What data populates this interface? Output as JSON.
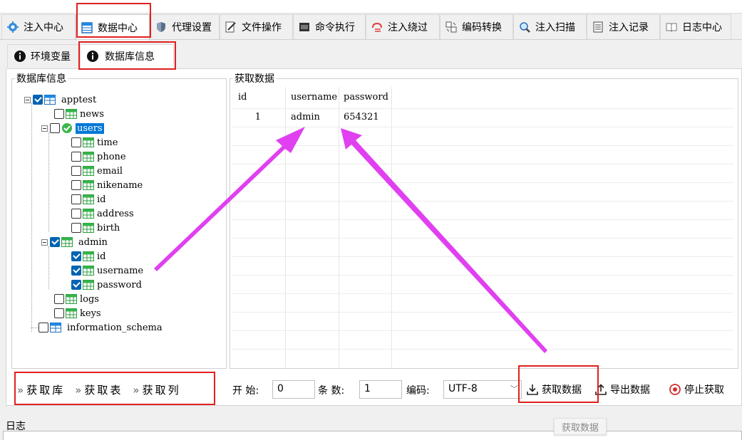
{
  "main_tabs": [
    {
      "label": "注入中心",
      "icon": "gear-icon"
    },
    {
      "label": "数据中心",
      "icon": "database-icon",
      "active": true
    },
    {
      "label": "代理设置",
      "icon": "shield-icon"
    },
    {
      "label": "文件操作",
      "icon": "edit-file-icon"
    },
    {
      "label": "命令执行",
      "icon": "terminal-icon"
    },
    {
      "label": "注入绕过",
      "icon": "bypass-icon"
    },
    {
      "label": "编码转换",
      "icon": "encode-icon"
    },
    {
      "label": "注入扫描",
      "icon": "scan-icon"
    },
    {
      "label": "注入记录",
      "icon": "record-icon"
    },
    {
      "label": "日志中心",
      "icon": "book-icon"
    }
  ],
  "sub_tabs": [
    {
      "label": "环境变量",
      "icon": "info-icon"
    },
    {
      "label": "数据库信息",
      "icon": "info-icon",
      "active": true
    }
  ],
  "db_panel": {
    "title": "数据库信息",
    "tree": [
      {
        "label": "apptest",
        "level": 0,
        "checked": true,
        "expanded": true,
        "kind": "database"
      },
      {
        "label": "news",
        "level": 1,
        "checked": false,
        "kind": "table"
      },
      {
        "label": "users",
        "level": 1,
        "checked": false,
        "expanded": true,
        "kind": "table-ok",
        "selected": true
      },
      {
        "label": "time",
        "level": 2,
        "checked": false,
        "kind": "column"
      },
      {
        "label": "phone",
        "level": 2,
        "checked": false,
        "kind": "column"
      },
      {
        "label": "email",
        "level": 2,
        "checked": false,
        "kind": "column"
      },
      {
        "label": "nikename",
        "level": 2,
        "checked": false,
        "kind": "column"
      },
      {
        "label": "id",
        "level": 2,
        "checked": false,
        "kind": "column"
      },
      {
        "label": "address",
        "level": 2,
        "checked": false,
        "kind": "column"
      },
      {
        "label": "birth",
        "level": 2,
        "checked": false,
        "kind": "column"
      },
      {
        "label": "admin",
        "level": 1,
        "checked": true,
        "expanded": true,
        "kind": "table"
      },
      {
        "label": "id",
        "level": 2,
        "checked": true,
        "kind": "column"
      },
      {
        "label": "username",
        "level": 2,
        "checked": true,
        "kind": "column"
      },
      {
        "label": "password",
        "level": 2,
        "checked": true,
        "kind": "column"
      },
      {
        "label": "logs",
        "level": 1,
        "checked": false,
        "kind": "table"
      },
      {
        "label": "keys",
        "level": 1,
        "checked": false,
        "kind": "table"
      },
      {
        "label": "information_schema",
        "level": 0,
        "checked": false,
        "kind": "database"
      }
    ],
    "actions": [
      {
        "label": "获取库"
      },
      {
        "label": "获取表"
      },
      {
        "label": "获取列"
      }
    ]
  },
  "fetch_panel": {
    "title": "获取数据",
    "columns": [
      "id",
      "username",
      "password"
    ],
    "rows": [
      [
        "1",
        "admin",
        "654321"
      ]
    ],
    "start_label": "开 始:",
    "start_value": "0",
    "count_label": "条 数:",
    "count_value": "1",
    "encoding_label": "编码:",
    "encoding_value": "UTF-8",
    "fetch_button": "获取数据",
    "export_button": "导出数据",
    "stop_button": "停止获取"
  },
  "log": {
    "title": "日志"
  },
  "tooltip": "获取数据",
  "colors": {
    "highlight_box": "#e02020",
    "arrow": "#e040f0",
    "selection": "#0078d7",
    "checkbox_on": "#0063b1"
  }
}
